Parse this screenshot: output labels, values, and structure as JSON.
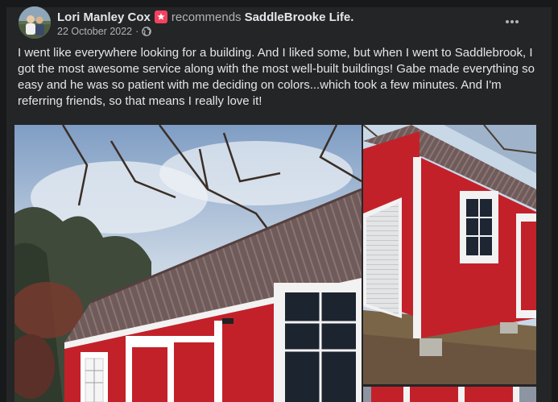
{
  "post": {
    "author": "Lori Manley Cox",
    "action": "recommends",
    "page_name": "SaddleBrooke Life.",
    "date": "22 October 2022",
    "separator": "·",
    "privacy_icon": "globe-icon",
    "recommend_icon": "recommend-badge-icon",
    "more_icon": "more-options-icon",
    "text": "I went like everywhere looking for a building. And I liked some, but when I went to Saddlebrook, I got the most awesome service along with the most well-built buildings! Gabe made everything so easy and he was so patient with me deciding on colors...which took a few minutes. And I'm referring friends, so that means I really love it!"
  },
  "colors": {
    "background": "#18191a",
    "card": "#242526",
    "primary_text": "#e4e6eb",
    "secondary_text": "#b0b3b8",
    "recommend_badge": "#f3425f",
    "barn_red": "#c3212a",
    "roof_metal": "#6e5a59",
    "trim_white": "#f2f2f2"
  },
  "photos": [
    {
      "subject": "red-barn-shed-side-view"
    },
    {
      "subject": "red-barn-shed-corner-view"
    },
    {
      "subject": "red-barn-shed-partial"
    }
  ]
}
